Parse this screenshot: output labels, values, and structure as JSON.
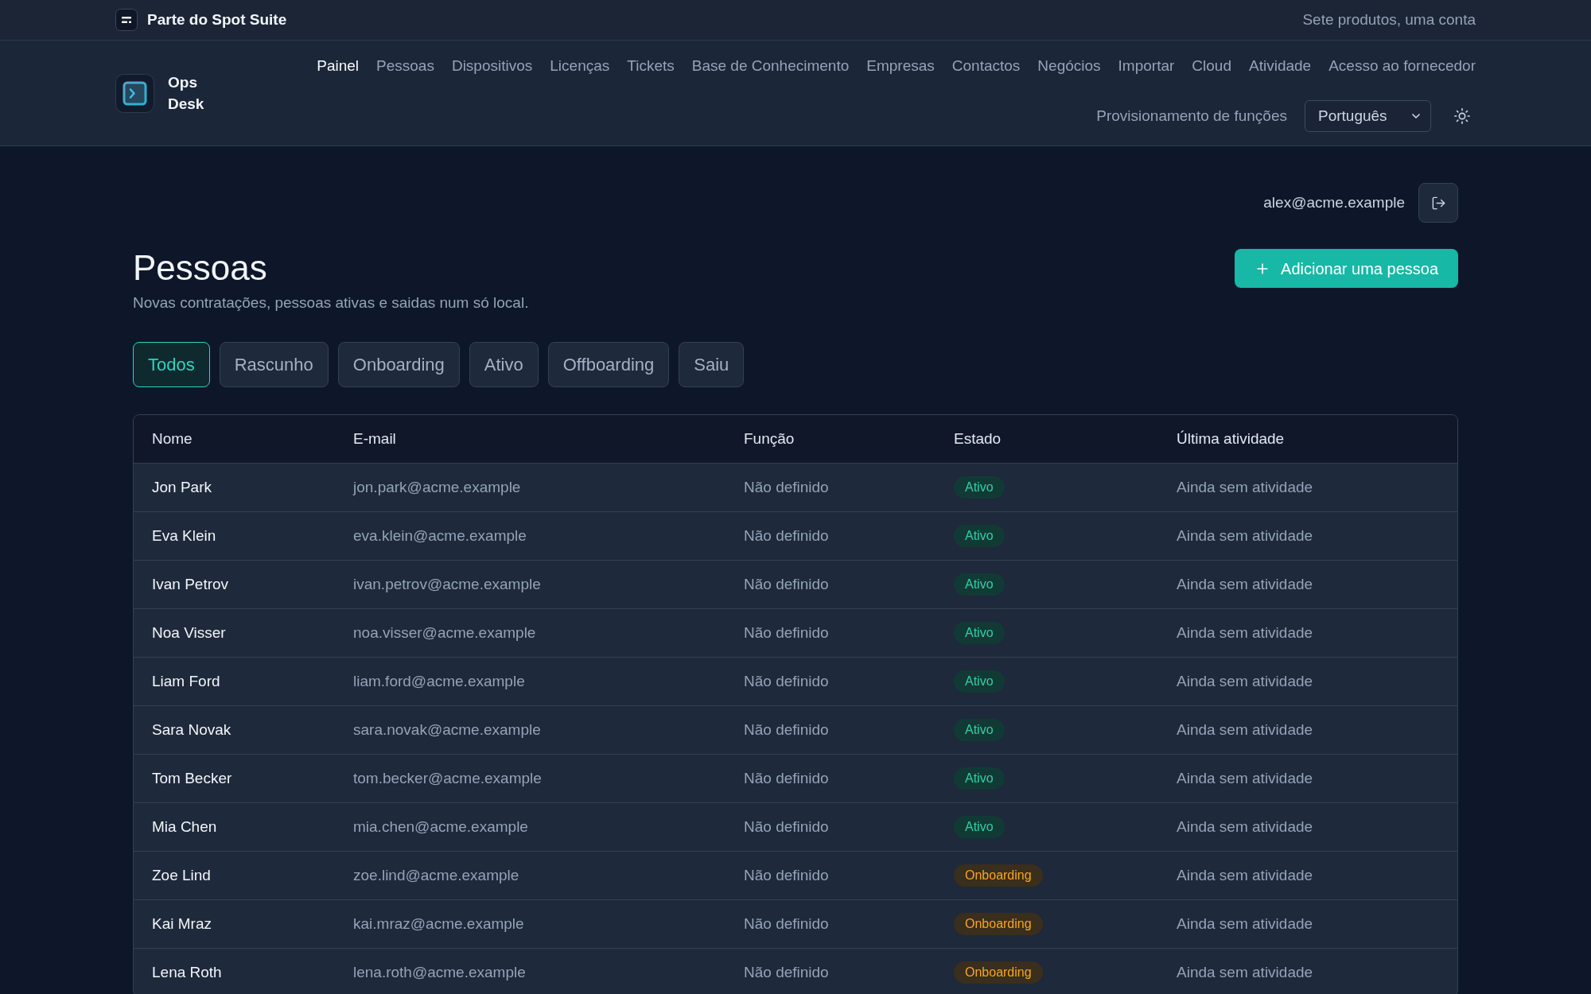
{
  "suite_bar": {
    "title": "Parte do Spot Suite",
    "tagline": "Sete produtos, uma conta"
  },
  "app": {
    "name": "Ops Desk"
  },
  "nav": {
    "links": [
      {
        "label": "Painel",
        "selected": true
      },
      {
        "label": "Pessoas",
        "selected": false
      },
      {
        "label": "Dispositivos",
        "selected": false
      },
      {
        "label": "Licenças",
        "selected": false
      },
      {
        "label": "Tickets",
        "selected": false
      },
      {
        "label": "Base de Conhecimento",
        "selected": false
      },
      {
        "label": "Empresas",
        "selected": false
      },
      {
        "label": "Contactos",
        "selected": false
      },
      {
        "label": "Negócios",
        "selected": false
      },
      {
        "label": "Importar",
        "selected": false
      },
      {
        "label": "Cloud",
        "selected": false
      },
      {
        "label": "Atividade",
        "selected": false
      },
      {
        "label": "Acesso ao fornecedor",
        "selected": false
      }
    ],
    "secondary_links": [
      {
        "label": "Provisionamento de funções",
        "selected": false
      }
    ],
    "language": {
      "value": "Português"
    }
  },
  "user": {
    "email": "alex@acme.example"
  },
  "page": {
    "title": "Pessoas",
    "subtitle": "Novas contratações, pessoas ativas e saidas num só local.",
    "add_button": "Adicionar uma pessoa"
  },
  "filters": [
    {
      "label": "Todos",
      "selected": true
    },
    {
      "label": "Rascunho",
      "selected": false
    },
    {
      "label": "Onboarding",
      "selected": false
    },
    {
      "label": "Ativo",
      "selected": false
    },
    {
      "label": "Offboarding",
      "selected": false
    },
    {
      "label": "Saiu",
      "selected": false
    }
  ],
  "table": {
    "columns": [
      "Nome",
      "E-mail",
      "Função",
      "Estado",
      "Última atividade"
    ],
    "rows": [
      {
        "name": "Jon Park",
        "email": "jon.park@acme.example",
        "role": "Não definido",
        "status": {
          "label": "Ativo",
          "kind": "active"
        },
        "last_activity": "Ainda sem atividade"
      },
      {
        "name": "Eva Klein",
        "email": "eva.klein@acme.example",
        "role": "Não definido",
        "status": {
          "label": "Ativo",
          "kind": "active"
        },
        "last_activity": "Ainda sem atividade"
      },
      {
        "name": "Ivan Petrov",
        "email": "ivan.petrov@acme.example",
        "role": "Não definido",
        "status": {
          "label": "Ativo",
          "kind": "active"
        },
        "last_activity": "Ainda sem atividade"
      },
      {
        "name": "Noa Visser",
        "email": "noa.visser@acme.example",
        "role": "Não definido",
        "status": {
          "label": "Ativo",
          "kind": "active"
        },
        "last_activity": "Ainda sem atividade"
      },
      {
        "name": "Liam Ford",
        "email": "liam.ford@acme.example",
        "role": "Não definido",
        "status": {
          "label": "Ativo",
          "kind": "active"
        },
        "last_activity": "Ainda sem atividade"
      },
      {
        "name": "Sara Novak",
        "email": "sara.novak@acme.example",
        "role": "Não definido",
        "status": {
          "label": "Ativo",
          "kind": "active"
        },
        "last_activity": "Ainda sem atividade"
      },
      {
        "name": "Tom Becker",
        "email": "tom.becker@acme.example",
        "role": "Não definido",
        "status": {
          "label": "Ativo",
          "kind": "active"
        },
        "last_activity": "Ainda sem atividade"
      },
      {
        "name": "Mia Chen",
        "email": "mia.chen@acme.example",
        "role": "Não definido",
        "status": {
          "label": "Ativo",
          "kind": "active"
        },
        "last_activity": "Ainda sem atividade"
      },
      {
        "name": "Zoe Lind",
        "email": "zoe.lind@acme.example",
        "role": "Não definido",
        "status": {
          "label": "Onboarding",
          "kind": "onboarding"
        },
        "last_activity": "Ainda sem atividade"
      },
      {
        "name": "Kai Mraz",
        "email": "kai.mraz@acme.example",
        "role": "Não definido",
        "status": {
          "label": "Onboarding",
          "kind": "onboarding"
        },
        "last_activity": "Ainda sem atividade"
      },
      {
        "name": "Lena Roth",
        "email": "lena.roth@acme.example",
        "role": "Não definido",
        "status": {
          "label": "Onboarding",
          "kind": "onboarding"
        },
        "last_activity": "Ainda sem atividade"
      }
    ]
  }
}
